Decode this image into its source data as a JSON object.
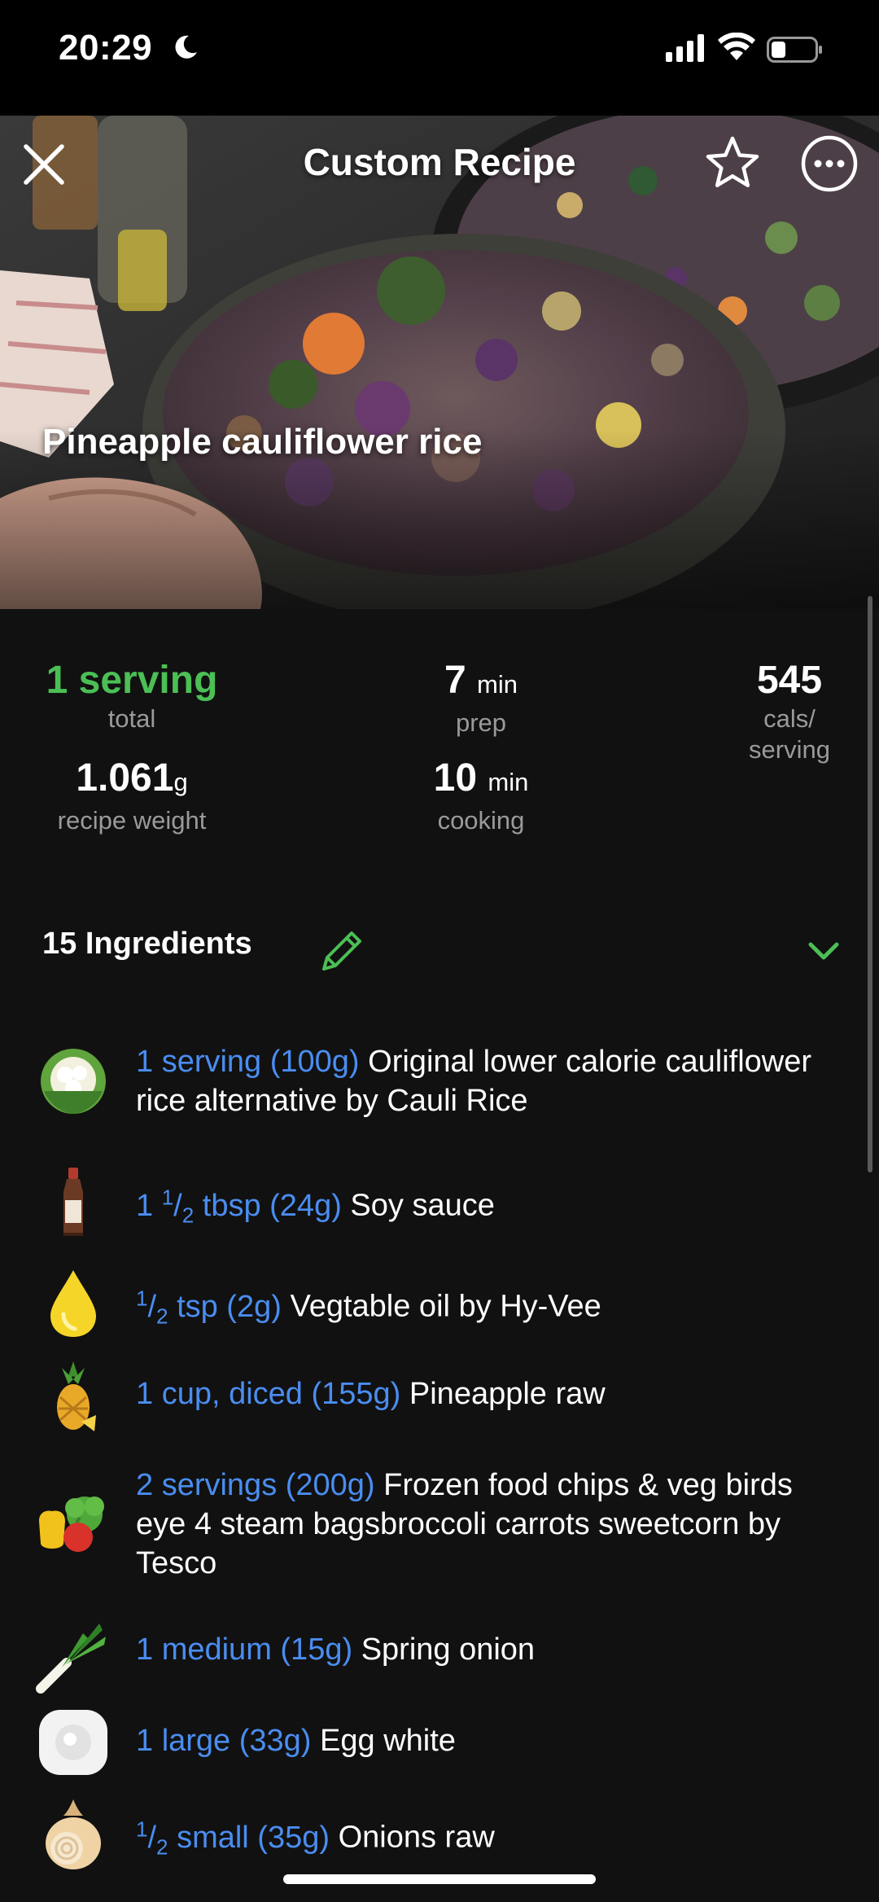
{
  "status_bar": {
    "time": "20:29",
    "moon_icon": "moon-icon",
    "signal_icon": "cellular-signal-icon",
    "wifi_icon": "wifi-icon",
    "battery_icon": "battery-icon"
  },
  "header": {
    "title": "Custom Recipe",
    "close_icon": "close-icon",
    "favorite_icon": "star-icon",
    "more_icon": "more-options-icon"
  },
  "recipe": {
    "name": "Pineapple cauliflower rice"
  },
  "stats": {
    "servings_value": "1 serving",
    "servings_label": "total",
    "weight_value": "1.061",
    "weight_unit": "g",
    "weight_label": "recipe weight",
    "prep_value": "7",
    "prep_unit": "min",
    "prep_label": "prep",
    "cooking_value": "10",
    "cooking_unit": "min",
    "cooking_label": "cooking",
    "cals_value": "545",
    "cals_label_line1": "cals/",
    "cals_label_line2": "serving"
  },
  "ingredients": {
    "header": "15 Ingredients",
    "edit_icon": "pencil-icon",
    "toggle_icon": "chevron-down-icon",
    "items": [
      {
        "icon": "cauliflower-icon",
        "amount": "1 serving (100g)",
        "name": "Original lower calorie cauliflower rice alternative by Cauli Rice"
      },
      {
        "icon": "soy-sauce-bottle-icon",
        "amount_whole": "1",
        "amount_num": "1",
        "amount_den": "2",
        "amount_rest": "tbsp (24g)",
        "name": "Soy sauce"
      },
      {
        "icon": "oil-drop-icon",
        "amount_num": "1",
        "amount_den": "2",
        "amount_rest": "tsp (2g)",
        "name": "Vegtable oil by Hy-Vee"
      },
      {
        "icon": "pineapple-icon",
        "amount": "1 cup, diced (155g)",
        "name": "Pineapple raw"
      },
      {
        "icon": "vegetables-icon",
        "amount": "2 servings (200g)",
        "name": "Frozen food chips & veg birds eye 4 steam bagsbroccoli carrots sweetcorn by Tesco"
      },
      {
        "icon": "leek-icon",
        "amount": "1 medium (15g)",
        "name": "Spring onion"
      },
      {
        "icon": "egg-icon",
        "amount": "1 large (33g)",
        "name": "Egg white"
      },
      {
        "icon": "onion-icon",
        "amount_num": "1",
        "amount_den": "2",
        "amount_rest": "small (35g)",
        "name": "Onions raw"
      }
    ]
  },
  "colors": {
    "accent_green": "#4bbf55",
    "amount_blue": "#4a8df0",
    "background": "#111111",
    "secondary_text": "#9a9a9a"
  }
}
